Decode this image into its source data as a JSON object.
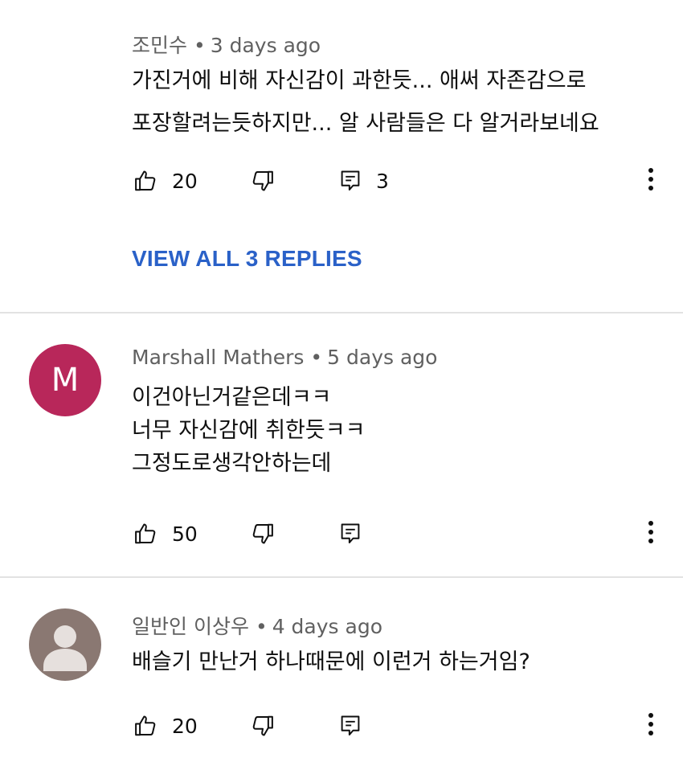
{
  "comments": [
    {
      "author": "조민수",
      "time": "3 days ago",
      "lines": [
        "가진거에 비해 자신감이 과한듯...  애써 자존감으로",
        "포장할려는듯하지만... 알 사람들은 다 알거라보네요"
      ],
      "likes": "20",
      "replies_count": "3",
      "view_replies_label": "VIEW ALL 3 REPLIES"
    },
    {
      "author": "Marshall Mathers",
      "avatar_letter": "M",
      "avatar_color": "#b8275a",
      "time": "5 days ago",
      "lines": [
        "이건아닌거같은데ㅋㅋ",
        "너무 자신감에 취한듯ㅋㅋ",
        "그정도로생각안하는데"
      ],
      "likes": "50"
    },
    {
      "author": "일반인 이상우",
      "avatar_color": "#8a7872",
      "time": "4 days ago",
      "lines": [
        "배슬기 만난거 하나때문에 이런거 하는거임?"
      ],
      "likes": "20"
    }
  ],
  "separator": "•",
  "icons": {
    "like": "thumbs-up-icon",
    "dislike": "thumbs-down-icon",
    "reply": "reply-icon",
    "more": "more-vert-icon"
  },
  "colors": {
    "link": "#2a61c8",
    "meta": "#606060",
    "divider": "#e2e2e2"
  }
}
